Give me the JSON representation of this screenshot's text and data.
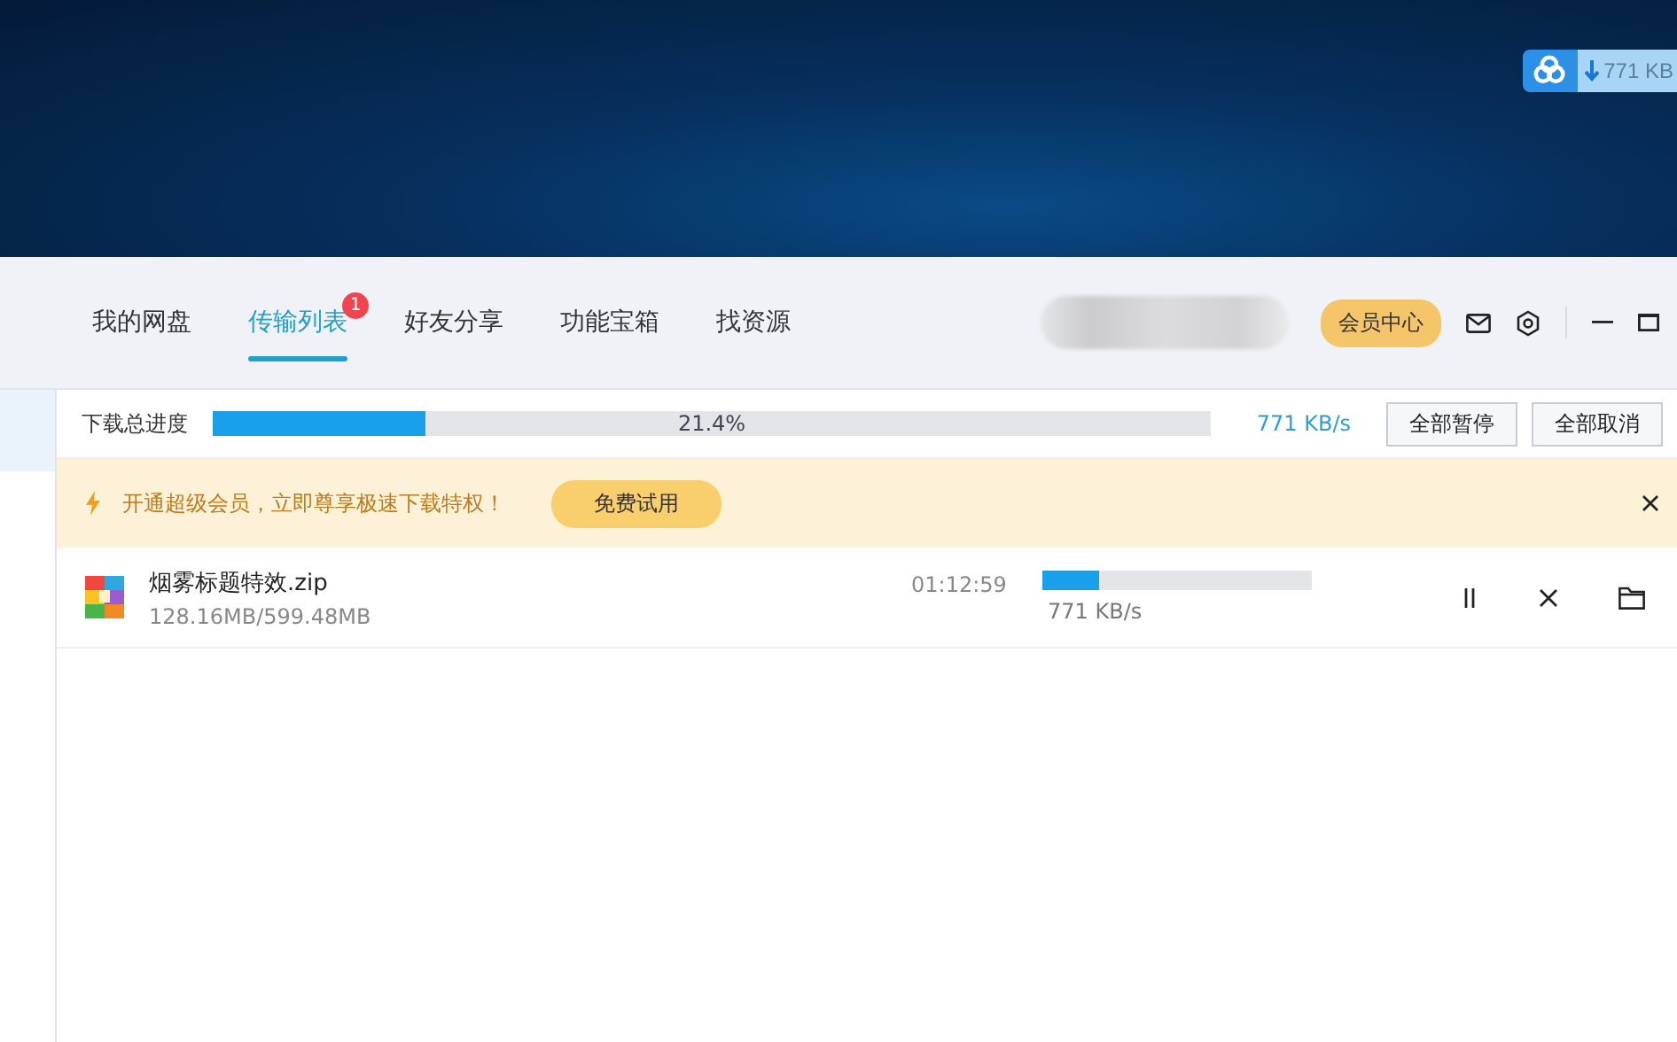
{
  "floating_widget": {
    "speed": "771 KB"
  },
  "nav_tabs": [
    {
      "label": "我的网盘",
      "selected": false
    },
    {
      "label": "传输列表",
      "selected": true,
      "badge": "1"
    },
    {
      "label": "好友分享",
      "selected": false
    },
    {
      "label": "功能宝箱",
      "selected": false
    },
    {
      "label": "找资源",
      "selected": false
    }
  ],
  "vip_button": "会员中心",
  "total_progress": {
    "label": "下载总进度",
    "level": 0.214,
    "percent": "21.4%",
    "speed": "771 KB/s"
  },
  "actions": [
    "全部暂停",
    "全部取消"
  ],
  "promo": {
    "text": "开通超级会员，立即尊享极速下载特权！",
    "button": "免费试用"
  },
  "downloads": [
    {
      "name": "烟雾标题特效.zip",
      "size": "128.16MB/599.48MB",
      "time_left": "01:12:59",
      "level": 0.21,
      "speed": "771 KB/s"
    }
  ]
}
